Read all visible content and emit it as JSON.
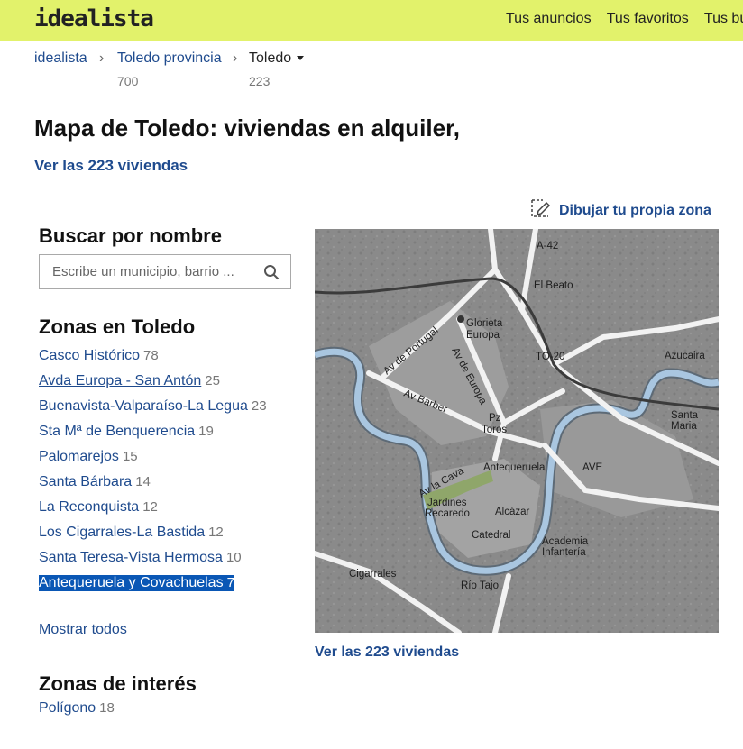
{
  "header": {
    "logo": "idealista",
    "nav": [
      "Tus anuncios",
      "Tus favoritos",
      "Tus bú"
    ]
  },
  "breadcrumb": [
    {
      "label": "idealista",
      "count": ""
    },
    {
      "label": "Toledo provincia",
      "count": "700"
    },
    {
      "label": "Toledo",
      "count": "223"
    }
  ],
  "page": {
    "title": "Mapa de Toledo: viviendas en alquiler,",
    "see_all": "Ver las 223 viviendas",
    "draw_zone": "Dibujar tu propia zona"
  },
  "search": {
    "heading": "Buscar por nombre",
    "placeholder": "Escribe un municipio, barrio ..."
  },
  "zones": {
    "heading": "Zonas en Toledo",
    "items": [
      {
        "label": "Casco Histórico",
        "count": "78"
      },
      {
        "label": "Avda Europa - San Antón",
        "count": "25"
      },
      {
        "label": "Buenavista-Valparaíso-La Legua",
        "count": "23"
      },
      {
        "label": "Sta Mª de Benquerencia",
        "count": "19"
      },
      {
        "label": "Palomarejos",
        "count": "15"
      },
      {
        "label": "Santa Bárbara",
        "count": "14"
      },
      {
        "label": "La Reconquista",
        "count": "12"
      },
      {
        "label": "Los Cigarrales-La Bastida",
        "count": "12"
      },
      {
        "label": "Santa Teresa-Vista Hermosa",
        "count": "10"
      },
      {
        "label": "Antequeruela y Covachuelas",
        "count": "7"
      }
    ],
    "show_all": "Mostrar todos"
  },
  "interest": {
    "heading": "Zonas de interés",
    "items": [
      {
        "label": "Polígono",
        "count": "18"
      }
    ]
  },
  "map": {
    "labels": [
      "A-42",
      "El Beato",
      "Glorieta Europa",
      "Av de Portugal",
      "Av de Europa",
      "TO-20",
      "Azucaira",
      "Av Barber",
      "Santa Maria",
      "Pz Toros",
      "Antequeruela",
      "AVE",
      "Av la Cava",
      "Jardines Recaredo",
      "Alcázar",
      "Catedral",
      "Academia Infantería",
      "Cigarrales",
      "Río Tajo"
    ]
  },
  "colors": {
    "topbar": "#e2f26b",
    "link": "#1f4b8e",
    "selection": "#0a57b5",
    "river": "#a9c6e0"
  }
}
